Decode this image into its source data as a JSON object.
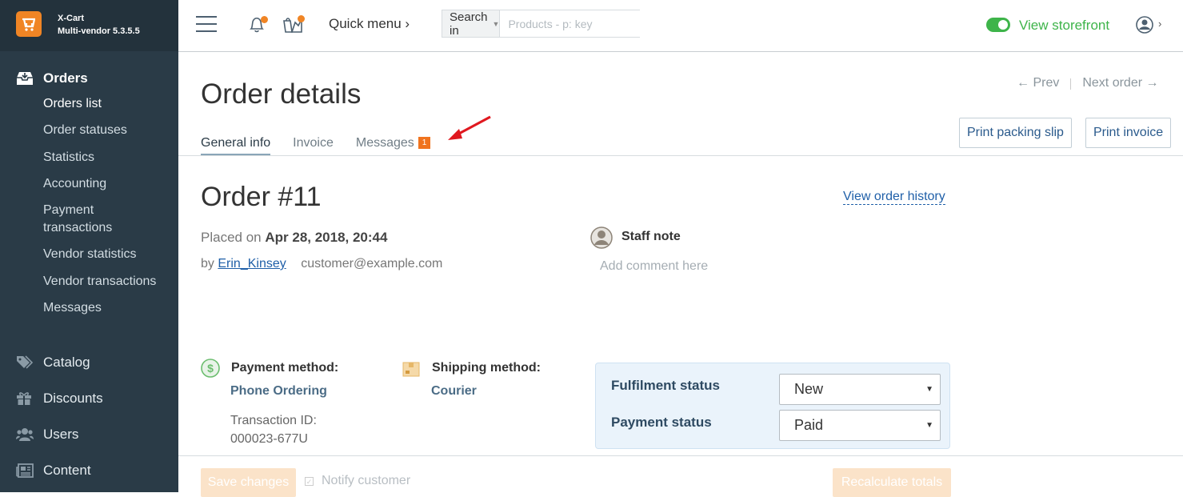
{
  "brand": {
    "name": "X-Cart",
    "edition": "Multi-vendor 5.3.5.5"
  },
  "sidebar": {
    "orders": {
      "title": "Orders",
      "items": [
        {
          "label": "Orders list",
          "active": true
        },
        {
          "label": "Order statuses"
        },
        {
          "label": "Statistics"
        },
        {
          "label": "Accounting"
        },
        {
          "label": "Payment transactions"
        },
        {
          "label": "Vendor statistics"
        },
        {
          "label": "Vendor transactions"
        },
        {
          "label": "Messages"
        }
      ]
    },
    "sections": [
      {
        "label": "Catalog",
        "icon": "tag-icon"
      },
      {
        "label": "Discounts",
        "icon": "gift-icon"
      },
      {
        "label": "Users",
        "icon": "users-icon"
      },
      {
        "label": "Content",
        "icon": "newspaper-icon"
      }
    ]
  },
  "topbar": {
    "quick_menu": "Quick menu ›",
    "search_in": "Search in",
    "search_placeholder": "Products - p: key",
    "view_storefront": "View storefront"
  },
  "page": {
    "title": "Order details",
    "prev": "← Prev",
    "next": "Next order →",
    "tabs": [
      {
        "label": "General info",
        "active": true
      },
      {
        "label": "Invoice"
      },
      {
        "label": "Messages",
        "badge": "1"
      }
    ],
    "print_packing_slip": "Print packing slip",
    "print_invoice": "Print invoice"
  },
  "order": {
    "number": "Order #11",
    "view_history": "View order history",
    "placed_on_label": "Placed on",
    "placed_on_value": "Apr 28, 2018, 20:44",
    "by_label": "by",
    "customer_name": "Erin_Kinsey",
    "customer_email": "customer@example.com",
    "staff_note_label": "Staff note",
    "comment_placeholder": "Add comment here",
    "payment_method_label": "Payment method:",
    "payment_method_value": "Phone Ordering",
    "transaction_id_label": "Transaction ID:",
    "transaction_id_value": "000023-677U",
    "shipping_method_label": "Shipping method:",
    "shipping_method_value": "Courier",
    "fulfilment_status_label": "Fulfilment status",
    "fulfilment_status_value": "New",
    "payment_status_label": "Payment status",
    "payment_status_value": "Paid"
  },
  "footer": {
    "save_changes": "Save changes",
    "notify_customer": "Notify customer",
    "recalculate_totals": "Recalculate totals"
  },
  "colors": {
    "sidebar_bg": "#2a3b47",
    "accent_orange": "#f08525",
    "link_blue": "#1f5fa8",
    "storefront_green": "#3eb44a"
  }
}
